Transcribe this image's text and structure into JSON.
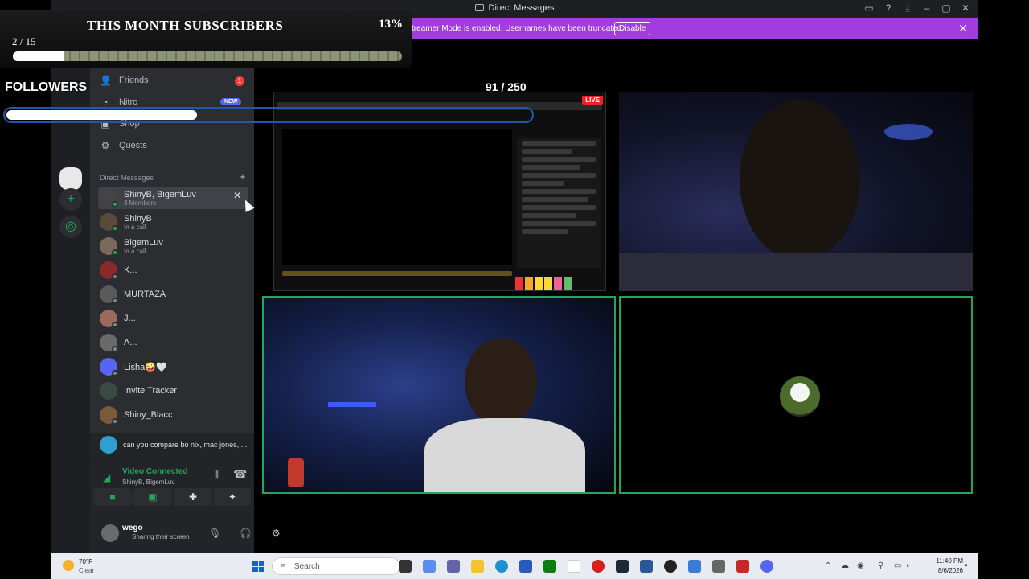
{
  "window": {
    "title": "Direct Messages",
    "streamer_banner": "treamer Mode is enabled. Usernames have been truncated.",
    "disable_label": "Disable"
  },
  "sidebar": {
    "nav": [
      {
        "label": "Friends",
        "icon": "friends-icon",
        "badge": "1"
      },
      {
        "label": "Nitro",
        "icon": "nitro-icon",
        "badge": "NEW"
      },
      {
        "label": "Shop",
        "icon": "shop-icon"
      },
      {
        "label": "Quests",
        "icon": "quests-icon"
      }
    ],
    "dm_header": "Direct Messages",
    "dms": [
      {
        "name": "ShinyB, BigemLuv",
        "sub": "3 Members"
      },
      {
        "name": "ShinyB",
        "sub": "In a call"
      },
      {
        "name": "BigemLuv",
        "sub": "In a call"
      },
      {
        "name": "K..."
      },
      {
        "name": "MURTAZA"
      },
      {
        "name": "J..."
      },
      {
        "name": "A..."
      },
      {
        "name": "Lisha🤪🤍"
      },
      {
        "name": "Invite Tracker"
      },
      {
        "name": "Shiny_Blacc"
      }
    ],
    "activity": "can you compare bo nix, mac jones, ...",
    "voice": {
      "status": "Video Connected",
      "users": "ShinyB, BigemLuv"
    },
    "user": {
      "name": "wego",
      "status": "Sharing their screen"
    }
  },
  "overlay": {
    "subscribers_title": "THIS MONTH SUBSCRIBERS",
    "subscribers_percent": "13%",
    "subscribers_count": "2 / 15",
    "subscribers_progress": 0.13,
    "followers_label": "FOLLOWERS",
    "followers_count": "91 / 250",
    "followers_progress": 0.364
  },
  "stream": {
    "live_label": "LIVE"
  },
  "taskbar": {
    "weather_temp": "70°F",
    "weather_desc": "Clear",
    "search_placeholder": "Search",
    "time": "11:40 PM",
    "date": "8/6/2026"
  },
  "colors": {
    "accent_green": "#23a55a",
    "banner_purple": "#a23be0",
    "sidebar_bg": "#2b2d31"
  }
}
